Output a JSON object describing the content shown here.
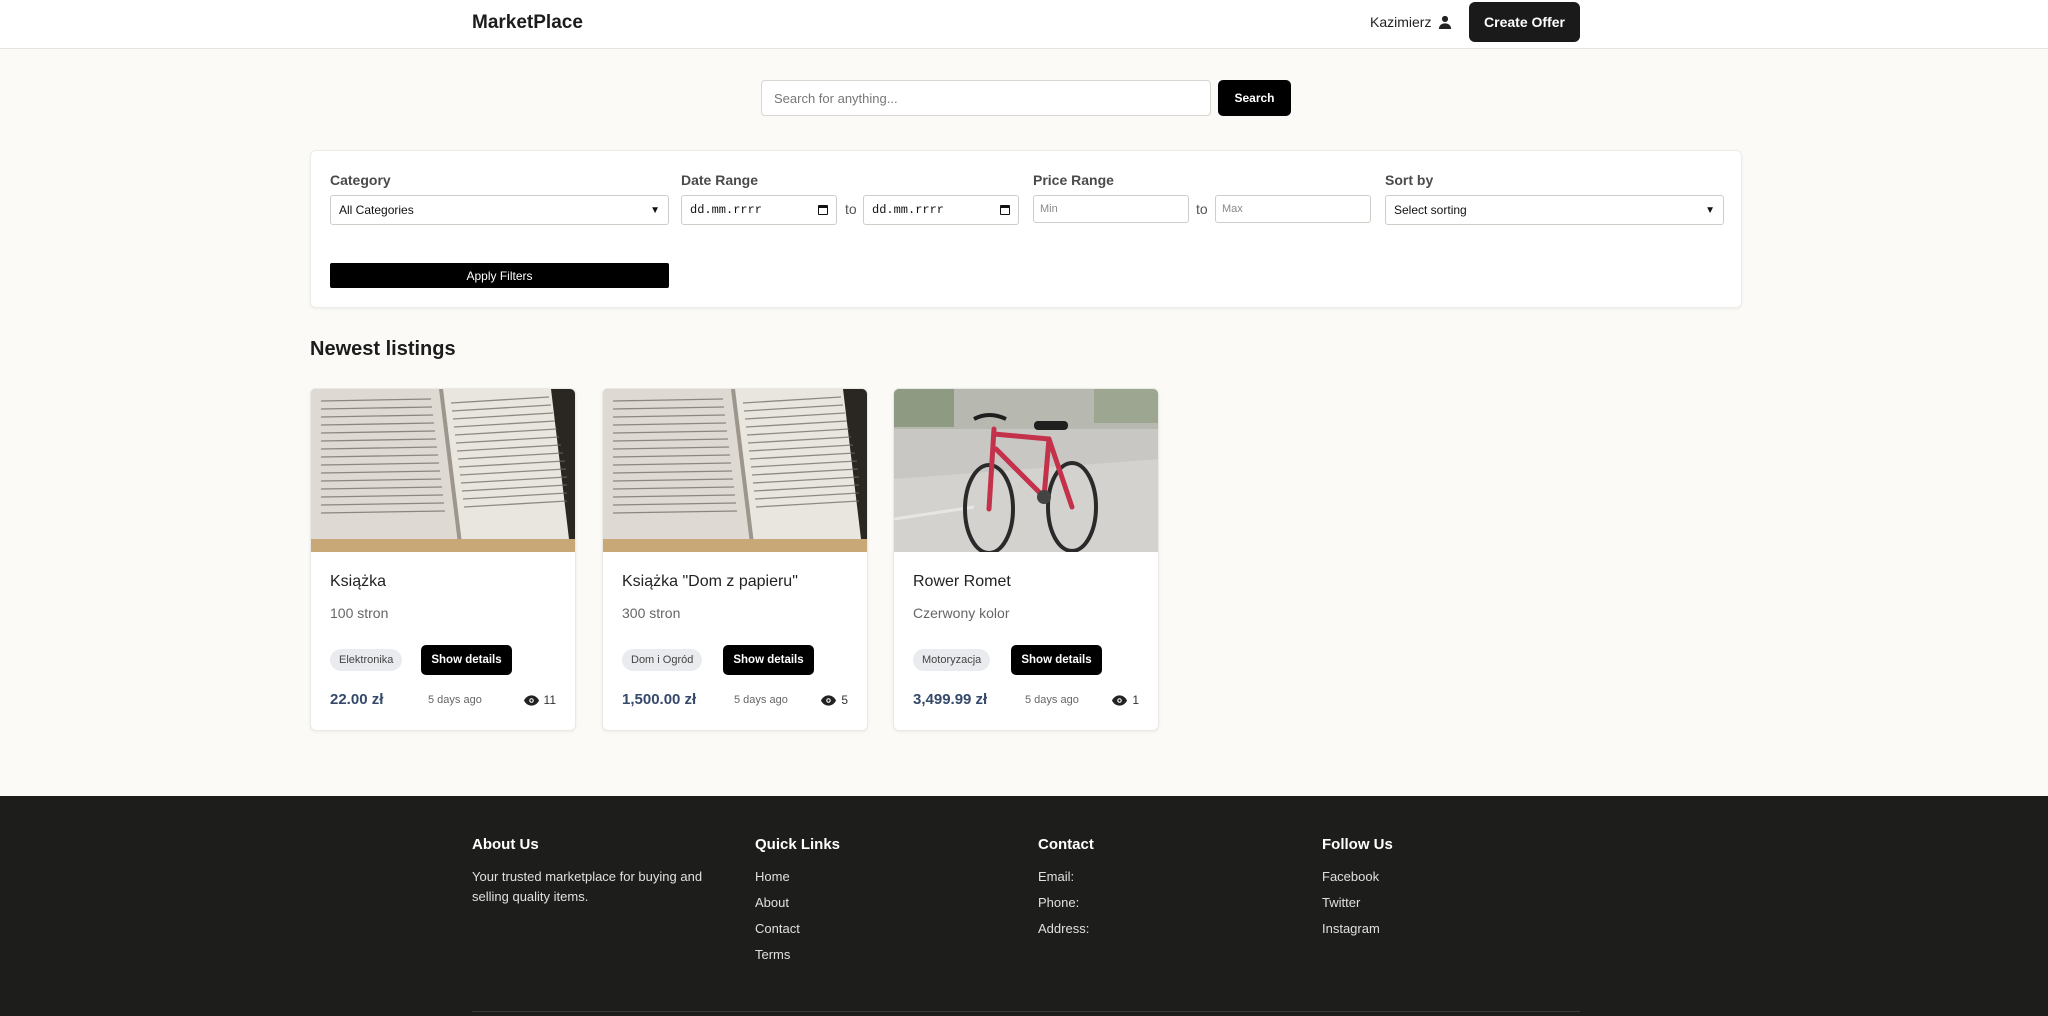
{
  "header": {
    "logo": "MarketPlace",
    "username": "Kazimierz",
    "create_offer": "Create Offer"
  },
  "search": {
    "placeholder": "Search for anything...",
    "button": "Search"
  },
  "filters": {
    "category_label": "Category",
    "category_value": "All Categories",
    "date_label": "Date Range",
    "date_from": "dd.mm.rrrr",
    "date_to": "dd.mm.rrrr",
    "to": "to",
    "price_label": "Price Range",
    "price_min": "Min",
    "price_max": "Max",
    "sort_label": "Sort by",
    "sort_value": "Select sorting",
    "apply": "Apply Filters"
  },
  "listings": {
    "title": "Newest listings",
    "items": [
      {
        "title": "Książka",
        "description": "100 stron",
        "category": "Elektronika",
        "button": "Show details",
        "price": "22.00 zł",
        "posted": "5 days ago",
        "views": "11",
        "image": "open-book-photo"
      },
      {
        "title": "Książka \"Dom z papieru\"",
        "description": "300 stron",
        "category": "Dom i Ogród",
        "button": "Show details",
        "price": "1,500.00 zł",
        "posted": "5 days ago",
        "views": "5",
        "image": "open-book-photo"
      },
      {
        "title": "Rower Romet",
        "description": "Czerwony kolor",
        "category": "Motoryzacja",
        "button": "Show details",
        "price": "3,499.99 zł",
        "posted": "5 days ago",
        "views": "1",
        "image": "red-bicycle-photo"
      }
    ]
  },
  "footer": {
    "about": {
      "heading": "About Us",
      "text": "Your trusted marketplace for buying and selling quality items."
    },
    "quick_links": {
      "heading": "Quick Links",
      "links": [
        "Home",
        "About",
        "Contact",
        "Terms"
      ]
    },
    "contact": {
      "heading": "Contact",
      "lines": [
        "Email:",
        "Phone:",
        "Address:"
      ]
    },
    "follow": {
      "heading": "Follow Us",
      "links": [
        "Facebook",
        "Twitter",
        "Instagram"
      ]
    }
  },
  "colors": {
    "page_bg": "#fbfaf7",
    "primary_button": "#000000",
    "price_text": "#35496b",
    "footer_bg": "#1d1d1b"
  }
}
